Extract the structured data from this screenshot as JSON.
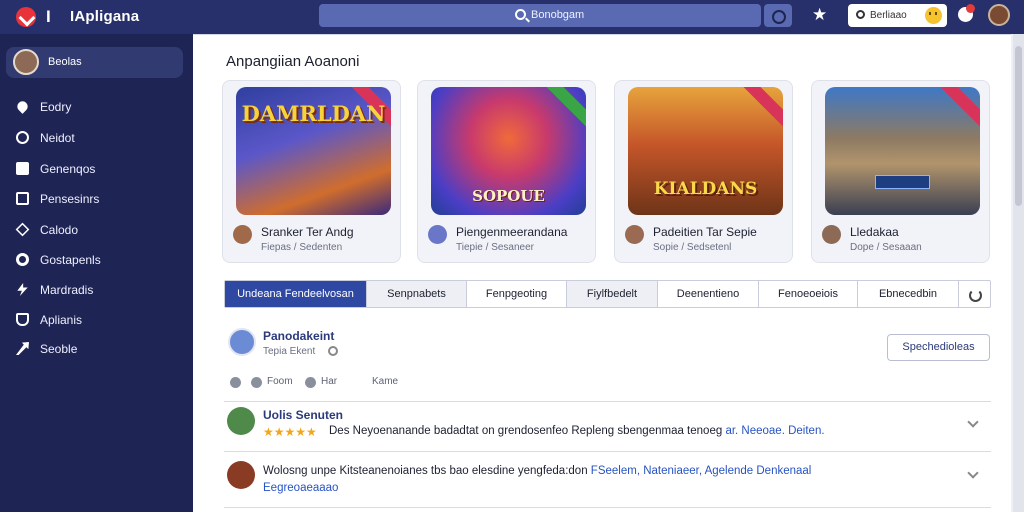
{
  "app": {
    "name": "IApligana"
  },
  "topbar": {
    "search_text": "Bonobgam",
    "user_label": "Berliaao"
  },
  "sidebar": {
    "profile_name": "Beolas",
    "items": [
      {
        "label": "Eodry",
        "icon": "fire-icon"
      },
      {
        "label": "Neidot",
        "icon": "compass-icon"
      },
      {
        "label": "Genenqos",
        "icon": "document-icon"
      },
      {
        "label": "Pensesinrs",
        "icon": "screen-icon"
      },
      {
        "label": "Calodo",
        "icon": "diamond-icon"
      },
      {
        "label": "Gostapenls",
        "icon": "ring-icon"
      },
      {
        "label": "Mardradis",
        "icon": "bolt-icon"
      },
      {
        "label": "Aplianis",
        "icon": "shield-icon"
      },
      {
        "label": "Seoble",
        "icon": "arrow-icon"
      }
    ]
  },
  "main": {
    "section_title": "Anpangiian Aoanoni",
    "cards": [
      {
        "art_title": "DAMRLDAN",
        "title": "Sranker Ter Andg",
        "subtitle": "Fiepas / Sedenten"
      },
      {
        "art_title": "SOPOUE",
        "title": "Piengenmeerandana",
        "subtitle": "Tiepie / Sesaneer"
      },
      {
        "art_title": "KIALDANS",
        "title": "Padeitien Tar Sepie",
        "subtitle": "Sopie / Sedsetenl"
      },
      {
        "art_title": "",
        "title": "Lledakaa",
        "subtitle": "Dope / Sesaaan"
      }
    ],
    "tabs": [
      "Undeana Fendeelvosan",
      "Senpnabets",
      "Fenpgeoting",
      "Fiylfbedelt",
      "Deenentieno",
      "Fenoeoeiois",
      "Ebnecedbin"
    ],
    "post": {
      "title": "Panodakeint",
      "subtitle": "Tepia Ekent",
      "follow_label": "Spechedioleas",
      "actions": [
        "Foom",
        "Har",
        "Kame"
      ]
    },
    "comments": [
      {
        "name": "Uolis Senuten",
        "text": "Des Neyoenanande badadtat on grendosenfeo Repleng sbengenmaa tenoeg",
        "link": "ar. Neeoae. Deiten."
      },
      {
        "text": "Wolosng unpe Kitsteanenoianes tbs bao elesdine yengfeda:don",
        "link": "FSeelem, Nateniaeer, Agelende Denkenaal",
        "second_line": "Eegreoaeaaao"
      }
    ]
  }
}
